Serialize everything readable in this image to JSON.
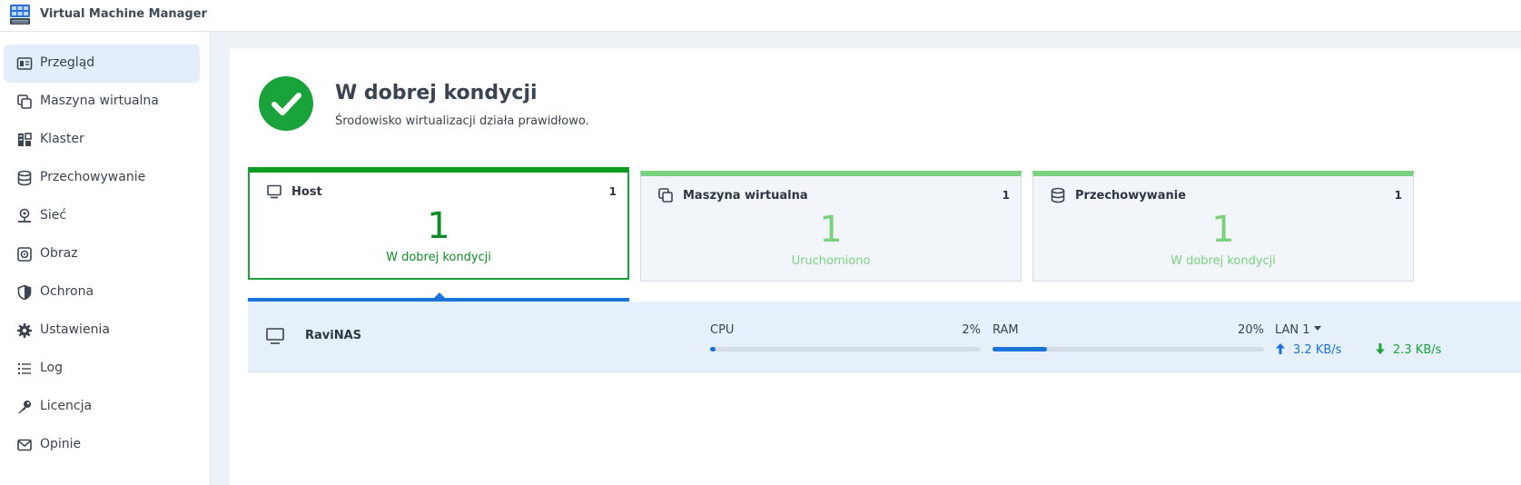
{
  "app": {
    "title": "Virtual Machine Manager"
  },
  "sidebar": {
    "items": [
      {
        "label": "Przegląd",
        "icon": "overview-icon",
        "active": true
      },
      {
        "label": "Maszyna wirtualna",
        "icon": "vm-icon"
      },
      {
        "label": "Klaster",
        "icon": "cluster-icon"
      },
      {
        "label": "Przechowywanie",
        "icon": "storage-icon"
      },
      {
        "label": "Sieć",
        "icon": "network-icon"
      },
      {
        "label": "Obraz",
        "icon": "image-icon"
      },
      {
        "label": "Ochrona",
        "icon": "shield-icon"
      },
      {
        "label": "Ustawienia",
        "icon": "gear-icon"
      },
      {
        "label": "Log",
        "icon": "list-icon"
      },
      {
        "label": "Licencja",
        "icon": "key-icon"
      },
      {
        "label": "Opinie",
        "icon": "mail-icon"
      }
    ]
  },
  "status": {
    "title": "W dobrej kondycji",
    "subtitle": "Środowisko wirtualizacji działa prawidłowo.",
    "color": "#1aa33a"
  },
  "cards": [
    {
      "title": "Host",
      "count": "1",
      "big": "1",
      "status": "W dobrej kondycji",
      "selected": true
    },
    {
      "title": "Maszyna wirtualna",
      "count": "1",
      "big": "1",
      "status": "Uruchomiono"
    },
    {
      "title": "Przechowywanie",
      "count": "1",
      "big": "1",
      "status": "W dobrej kondycji"
    }
  ],
  "host_row": {
    "name": "RaviNAS",
    "cpu": {
      "label": "CPU",
      "percent_text": "2%",
      "percent": 2
    },
    "ram": {
      "label": "RAM",
      "percent_text": "20%",
      "percent": 20
    },
    "lan": {
      "label": "LAN 1",
      "upload": "3.2 KB/s",
      "download": "2.3 KB/s"
    }
  },
  "colors": {
    "accent": "#1a73d9",
    "healthy": "#1aa33a",
    "healthy_light": "#7ad27e"
  }
}
